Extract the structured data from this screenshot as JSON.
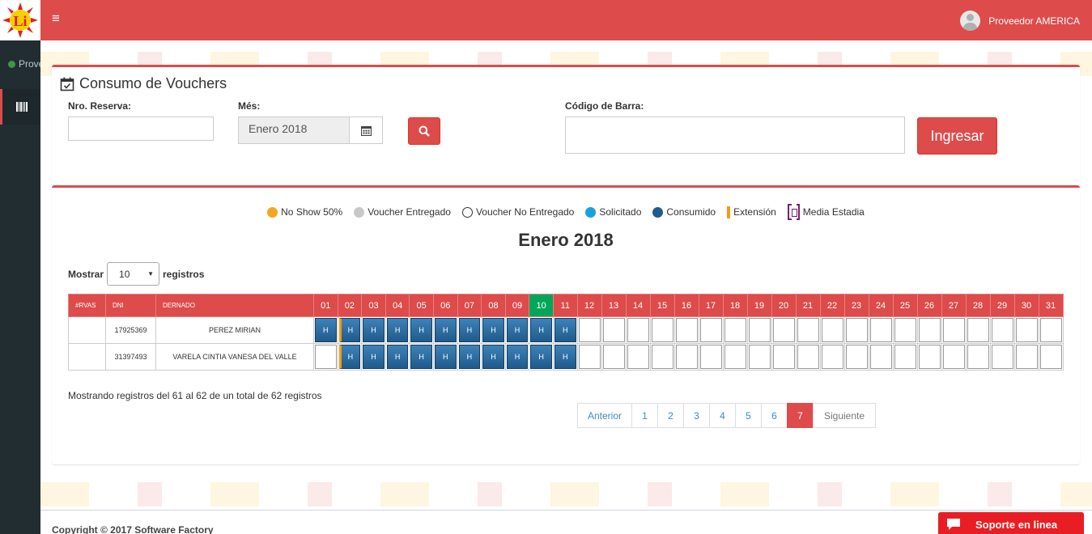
{
  "topbar": {
    "user_name": "Proveedor AMERICA"
  },
  "sidebar": {
    "user_status": "Proveedor AMERICA"
  },
  "form": {
    "title": "Consumo de Vouchers",
    "reserva_label": "Nro. Reserva:",
    "reserva_value": "",
    "mes_label": "Més:",
    "mes_value": "Enero 2018",
    "barcode_label": "Código de Barra:",
    "barcode_value": "",
    "ingresar_label": "Ingresar"
  },
  "legend": [
    {
      "label": "No Show 50%",
      "color": "#f5a623"
    },
    {
      "label": "Voucher Entregado",
      "color": "#c8c8c8"
    },
    {
      "label": "Voucher No Entregado",
      "color": "#ffffff"
    },
    {
      "label": "Solicitado",
      "color": "#1aa0e0"
    },
    {
      "label": "Consumido",
      "color": "#1f5b8c"
    },
    {
      "label": "Extensión",
      "color": "#f39c12"
    },
    {
      "label": "Media Estadia",
      "color": "#7b1f6e"
    }
  ],
  "calendar": {
    "title": "Enero 2018",
    "show_label": "Mostrar",
    "page_size": "10",
    "records_label": "registros",
    "headers": {
      "rvas": "#RVAS",
      "dni": "DNI",
      "name": "DERNADO"
    },
    "days": [
      "01",
      "02",
      "03",
      "04",
      "05",
      "06",
      "07",
      "08",
      "09",
      "10",
      "11",
      "12",
      "13",
      "14",
      "15",
      "16",
      "17",
      "18",
      "19",
      "20",
      "21",
      "22",
      "23",
      "24",
      "25",
      "26",
      "27",
      "28",
      "29",
      "30",
      "31"
    ],
    "today": "10",
    "rows": [
      {
        "rvas": "",
        "dni": "17925369",
        "name": "PEREZ MIRIAN",
        "cells": [
          "H",
          "H",
          "H",
          "H",
          "H",
          "H",
          "H",
          "H",
          "H",
          "H",
          "H",
          "",
          "",
          "",
          "",
          "",
          "",
          "",
          "",
          "",
          "",
          "",
          "",
          "",
          "",
          "",
          "",
          "",
          "",
          "",
          ""
        ],
        "extension_day": "02"
      },
      {
        "rvas": "",
        "dni": "31397493",
        "name": "VARELA CINTIA VANESA DEL VALLE",
        "cells": [
          "",
          "H",
          "H",
          "H",
          "H",
          "H",
          "H",
          "H",
          "H",
          "H",
          "H",
          "",
          "",
          "",
          "",
          "",
          "",
          "",
          "",
          "",
          "",
          "",
          "",
          "",
          "",
          "",
          "",
          "",
          "",
          "",
          ""
        ],
        "extension_day": "02"
      }
    ],
    "info": "Mostrando registros del 61 al 62 de un total de 62 registros",
    "pagination": {
      "prev": "Anterior",
      "pages": [
        "1",
        "2",
        "3",
        "4",
        "5",
        "6",
        "7"
      ],
      "active": "7",
      "next": "Siguiente"
    }
  },
  "footer": {
    "copyright": "Copyright © 2017 Software Factory",
    "support": "Soporte en linea"
  }
}
